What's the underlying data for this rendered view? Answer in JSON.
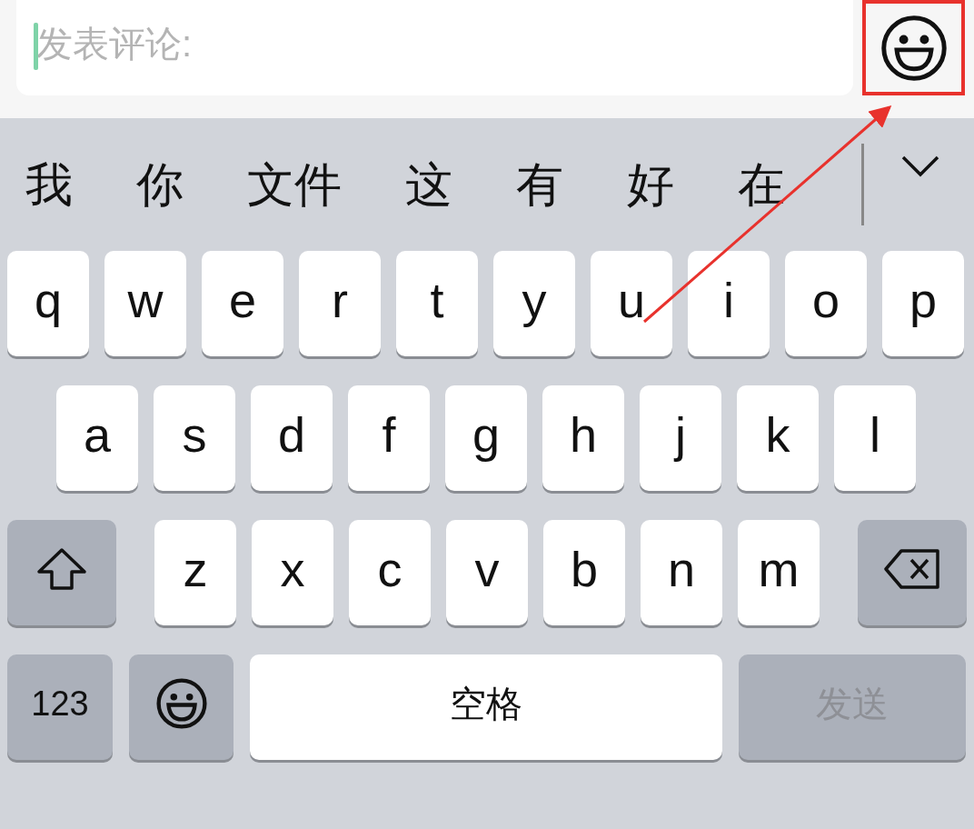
{
  "comment_bar": {
    "placeholder": "发表评论:",
    "emoji_button": {
      "highlighted": true
    }
  },
  "candidates": [
    "我",
    "你",
    "文件",
    "这",
    "有",
    "好",
    "在"
  ],
  "keyboard": {
    "letter_rows": [
      [
        "q",
        "w",
        "e",
        "r",
        "t",
        "y",
        "u",
        "i",
        "o",
        "p"
      ],
      [
        "a",
        "s",
        "d",
        "f",
        "g",
        "h",
        "j",
        "k",
        "l"
      ],
      [
        "z",
        "x",
        "c",
        "v",
        "b",
        "n",
        "m"
      ]
    ],
    "bottom_row": [
      {
        "kind": "numbers",
        "label": "123"
      },
      {
        "kind": "emoji"
      },
      {
        "kind": "space",
        "label": "空格"
      },
      {
        "kind": "send",
        "label": "发送",
        "disabled": true
      }
    ]
  },
  "annotation": {
    "arrow": true
  }
}
